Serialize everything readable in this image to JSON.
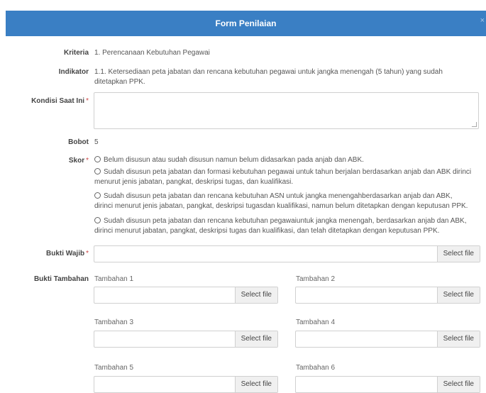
{
  "header": {
    "title": "Form Penilaian",
    "close": "×"
  },
  "fields": {
    "kriteria_label": "Kriteria",
    "kriteria_value": "1. Perencanaan Kebutuhan Pegawai",
    "indikator_label": "Indikator",
    "indikator_line1": "1.1. Ketersediaan peta jabatan dan rencana kebutuhan pegawai untuk jangka menengah (5 tahun) yang sudah",
    "indikator_line2": "ditetapkan PPK.",
    "kondisi_label": "Kondisi Saat Ini",
    "required_mark": "*",
    "bobot_label": "Bobot",
    "bobot_value": "5",
    "skor_label": "Skor",
    "bukti_wajib_label": "Bukti Wajib",
    "bukti_tambahan_label": "Bukti Tambahan",
    "select_file": "Select file"
  },
  "skor_options": [
    {
      "line1": "Belum disusun atau sudah disusun namun belum didasarkan pada anjab dan ABK.",
      "line2": ""
    },
    {
      "line1": "Sudah disusun peta jabatan dan formasi kebutuhan pegawai untuk tahun berjalan berdasarkan anjab dan ABK dirinci",
      "line2": "menurut jenis jabatan, pangkat, deskripsi tugas, dan kualifikasi."
    },
    {
      "line1": "Sudah disusun peta jabatan dan rencana kebutuhan ASN untuk jangka menengahberdasarkan anjab dan ABK,",
      "line2": "dirinci menurut jenis jabatan, pangkat, deskripsi tugasdan kualifikasi, namun belum ditetapkan dengan keputusan PPK."
    },
    {
      "line1": "Sudah disusun peta jabatan dan rencana kebutuhan pegawaiuntuk jangka menengah, berdasarkan anjab dan ABK,",
      "line2": "dirinci menurut jabatan, pangkat, deskripsi tugas dan kualifikasi, dan telah ditetapkan dengan keputusan PPK."
    }
  ],
  "tambahan": [
    "Tambahan 1",
    "Tambahan 2",
    "Tambahan 3",
    "Tambahan 4",
    "Tambahan 5",
    "Tambahan 6"
  ]
}
